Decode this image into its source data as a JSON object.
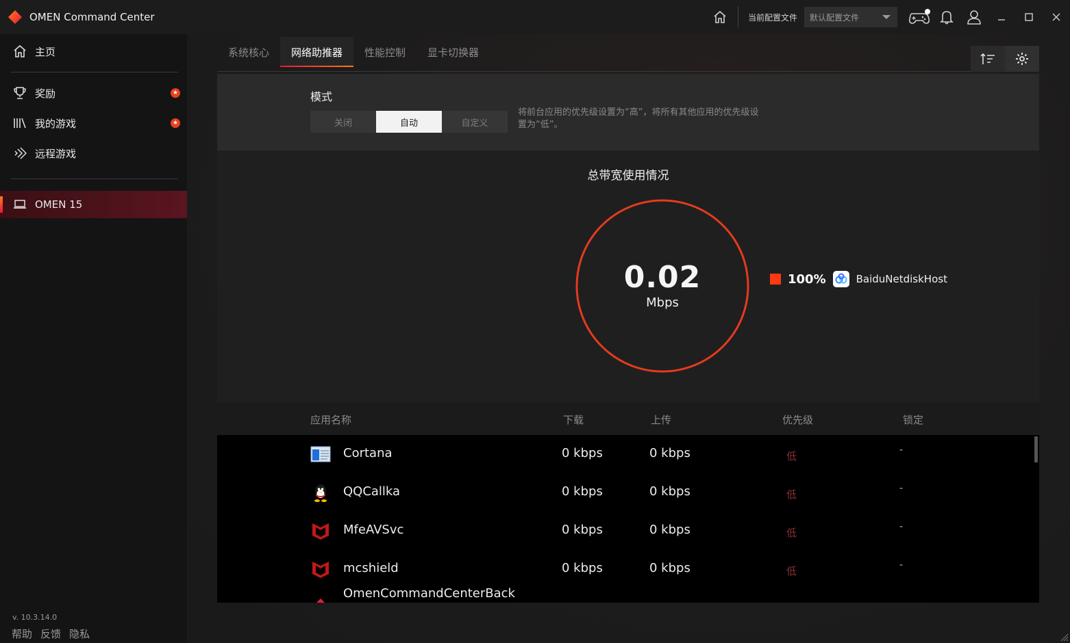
{
  "titlebar": {
    "app_title": "OMEN Command Center",
    "profile_label": "当前配置文件",
    "profile_value": "默认配置文件"
  },
  "sidebar": {
    "items": [
      {
        "label": "主页"
      },
      {
        "label": "奖励"
      },
      {
        "label": "我的游戏"
      },
      {
        "label": "远程游戏"
      }
    ],
    "device": "OMEN 15",
    "version": "v. 10.3.14.0",
    "footer": [
      "帮助",
      "反馈",
      "隐私"
    ]
  },
  "tabs": [
    "系统核心",
    "网络助推器",
    "性能控制",
    "显卡切换器"
  ],
  "mode": {
    "title": "模式",
    "options": [
      "关闭",
      "自动",
      "自定义"
    ],
    "selected": "自动",
    "description": "将前台应用的优先级设置为“高”，将所有其他应用的优先级设置为“低”。"
  },
  "bandwidth": {
    "title": "总带宽使用情况",
    "value": "0.02",
    "unit": "Mbps",
    "legend": [
      {
        "percent": "100%",
        "name": "BaiduNetdiskHost",
        "color": "#ff3a12"
      }
    ]
  },
  "table": {
    "headers": [
      "应用名称",
      "下载",
      "上传",
      "优先级",
      "锁定"
    ],
    "rows": [
      {
        "name": "Cortana",
        "download": "0 kbps",
        "upload": "0 kbps",
        "priority": "低",
        "lock": "-"
      },
      {
        "name": "QQCallka",
        "download": "0 kbps",
        "upload": "0 kbps",
        "priority": "低",
        "lock": "-"
      },
      {
        "name": "MfeAVSvc",
        "download": "0 kbps",
        "upload": "0 kbps",
        "priority": "低",
        "lock": "-"
      },
      {
        "name": "mcshield",
        "download": "0 kbps",
        "upload": "0 kbps",
        "priority": "低",
        "lock": "-"
      },
      {
        "name": "OmenCommandCenterBack",
        "download": "",
        "upload": "",
        "priority": "",
        "lock": ""
      }
    ]
  },
  "colors": {
    "accent": "#e8401e",
    "ring": "#e53a1f",
    "priority_low": "#8a3038"
  }
}
